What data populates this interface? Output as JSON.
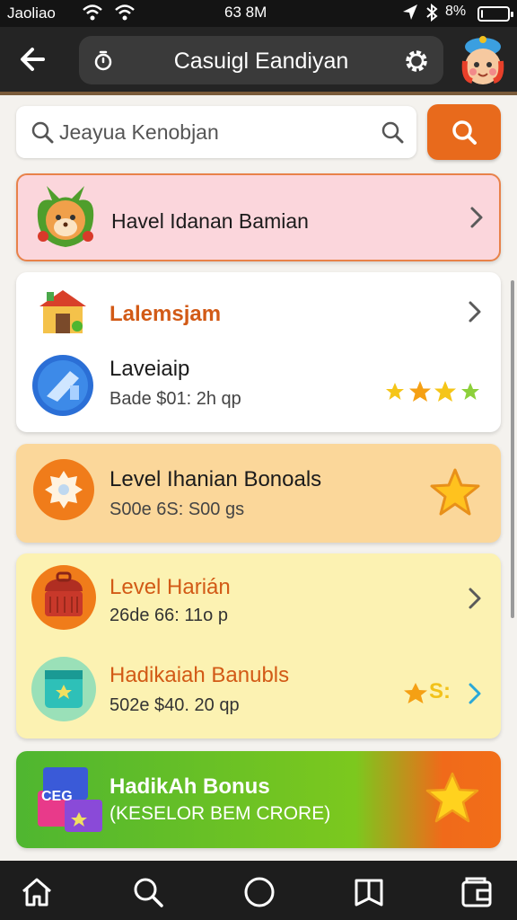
{
  "status_bar": {
    "carrier": "Jaoliao",
    "time": "63 8M",
    "battery": "8%",
    "battery_level": 0.08
  },
  "header": {
    "title": "Casuigl Eandiyan"
  },
  "search": {
    "placeholder": "Jeayua Kenobjan"
  },
  "cards": [
    {
      "title": "Havel Idanan Bamian"
    },
    {
      "title": "Lalemsjam",
      "sub_title": "Laveiaip",
      "sub_text": "Bade $01: 2h qp",
      "stars": 4
    },
    {
      "title": "Level Ihanian Bonoals",
      "sub_text": "S00e 6S: S00 gs"
    },
    {
      "title": "Level Harián",
      "sub_text": "26de 66: 11o p",
      "item2_title": "Hadikaiah Banubls",
      "item2_text": "502e $40. 20 qp",
      "badge": "S:"
    },
    {
      "title": "HadikAh Bonus",
      "sub_text": "(KESELOR BEM CRORE)",
      "icon_text": "CEG"
    }
  ],
  "colors": {
    "accent_orange": "#e86a1c",
    "title_orange": "#d25a16",
    "green_banner": "#4fb630"
  }
}
